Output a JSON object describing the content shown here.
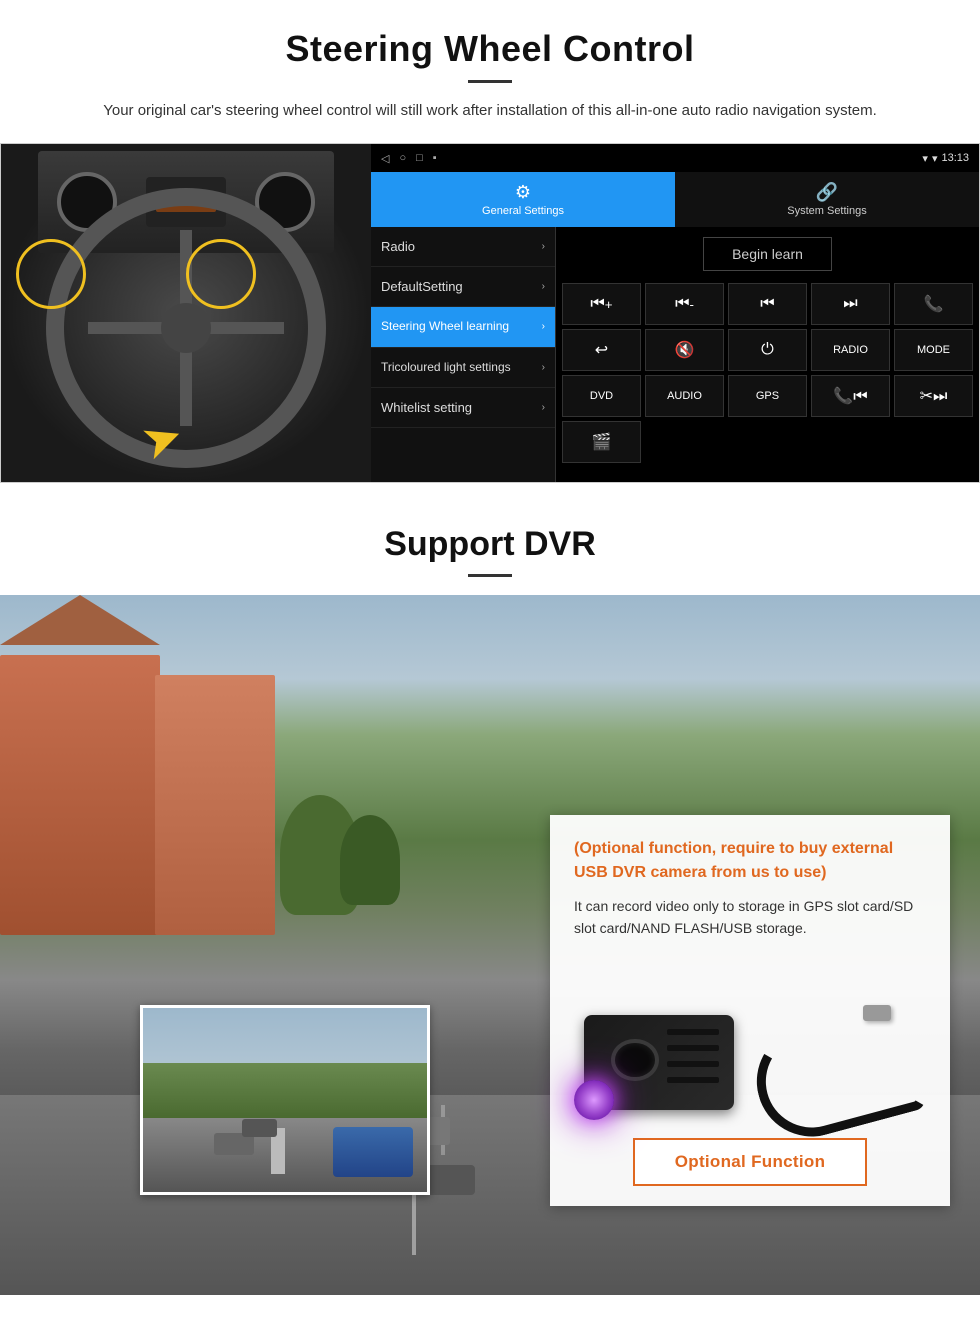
{
  "steering": {
    "title": "Steering Wheel Control",
    "description": "Your original car's steering wheel control will still work after installation of this all-in-one auto radio navigation system.",
    "nav_icons": [
      "◁",
      "○",
      "□",
      "▪"
    ],
    "status_time": "13:13",
    "tabs": [
      {
        "id": "general",
        "icon": "⚙",
        "label": "General Settings",
        "active": true
      },
      {
        "id": "system",
        "icon": "🔗",
        "label": "System Settings",
        "active": false
      }
    ],
    "menu_items": [
      {
        "id": "radio",
        "label": "Radio",
        "active": false
      },
      {
        "id": "default",
        "label": "DefaultSetting",
        "active": false
      },
      {
        "id": "steering",
        "label": "Steering Wheel learning",
        "active": true
      },
      {
        "id": "tricoloured",
        "label": "Tricoloured light settings",
        "active": false
      },
      {
        "id": "whitelist",
        "label": "Whitelist setting",
        "active": false
      }
    ],
    "begin_learn_label": "Begin learn",
    "control_buttons": [
      "⏮+",
      "⏮-",
      "⏮⏮",
      "⏭⏭",
      "📞",
      "↩",
      "🔇×",
      "⏻",
      "RADIO",
      "MODE",
      "DVD",
      "AUDIO",
      "GPS",
      "📞⏮",
      "✂⏭",
      "🎬"
    ]
  },
  "dvr": {
    "title": "Support DVR",
    "optional_text": "(Optional function, require to buy external USB DVR camera from us to use)",
    "description": "It can record video only to storage in GPS slot card/SD slot card/NAND FLASH/USB storage.",
    "optional_button_label": "Optional Function"
  }
}
